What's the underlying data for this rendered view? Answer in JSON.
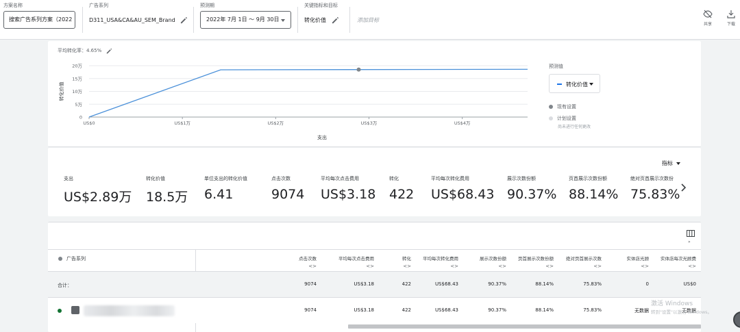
{
  "topbar": {
    "plan_label": "方案名称",
    "plan_value": "搜索广告系列方案（2022",
    "campaign_label": "广告系列",
    "campaign_value": "D311_USA&CA&AU_SEM_Brand",
    "forecast_label": "预测期",
    "forecast_value": "2022年 7月 1日 ～ 9月 30日",
    "kpi_label": "关键指标和目标",
    "kpi_value": "转化价值",
    "goal_placeholder": "添加目标",
    "share_label": "共享",
    "download_label": "下载"
  },
  "chart": {
    "avg_label": "平均转化率：4.65%",
    "legend_title": "预测值",
    "metric_select": "转化价值",
    "legend_current": "现有设置",
    "legend_planned": "计划设置",
    "legend_planned_sub": "尚未进行任何更改"
  },
  "chart_data": {
    "type": "line",
    "xlabel": "支出",
    "ylabel": "转化价值",
    "x_ticks": [
      "US$0",
      "US$1万",
      "US$2万",
      "US$3万",
      "US$4万"
    ],
    "y_ticks": [
      "0",
      "5万",
      "10万",
      "15万",
      "20万"
    ],
    "xlim": [
      0,
      47000
    ],
    "ylim": [
      0,
      200000
    ],
    "series": [
      {
        "name": "现有设置",
        "color": "#4a90d9",
        "x": [
          0,
          14100,
          47000
        ],
        "y": [
          0,
          184000,
          186000
        ]
      }
    ],
    "current_point": {
      "x": 28900,
      "y": 185000
    }
  },
  "metrics": {
    "menu_label": "指标",
    "items": [
      {
        "label": "支出",
        "value": "US$2.89万"
      },
      {
        "label": "转化价值",
        "value": "18.5万"
      },
      {
        "label": "单位支出的转化价值",
        "value": "6.41"
      },
      {
        "label": "点击次数",
        "value": "9074"
      },
      {
        "label": "平均每次点击费用",
        "value": "US$3.18"
      },
      {
        "label": "转化",
        "value": "422"
      },
      {
        "label": "平均每次转化费用",
        "value": "US$68.43"
      },
      {
        "label": "展示次数份额",
        "value": "90.37%"
      },
      {
        "label": "页首展示次数份额",
        "value": "88.14%"
      },
      {
        "label": "绝对页首展示次数份",
        "value": "75.83%"
      }
    ]
  },
  "table": {
    "name_header": "广告系列",
    "sort_glyph": "<>",
    "columns": [
      "点击次数",
      "平均每次点击费用",
      "转化",
      "平均每次转化费用",
      "展示次数份额",
      "页首展示次数份额",
      "绝对页首展示次数",
      "实体店光顾",
      "实体店每次光顾费"
    ],
    "total_label": "合计：",
    "total_row": [
      "9074",
      "US$3.18",
      "422",
      "US$68.43",
      "90.37%",
      "88.14%",
      "75.83%",
      "0",
      "US$0"
    ],
    "data_row": [
      "9074",
      "US$3.18",
      "422",
      "US$68.43",
      "90.37%",
      "88.14%",
      "75.83%",
      "无数据",
      "无数据"
    ]
  },
  "watermark": {
    "title": "激活 Windows",
    "sub": "转到\"设置\"以激活 Windows。"
  }
}
